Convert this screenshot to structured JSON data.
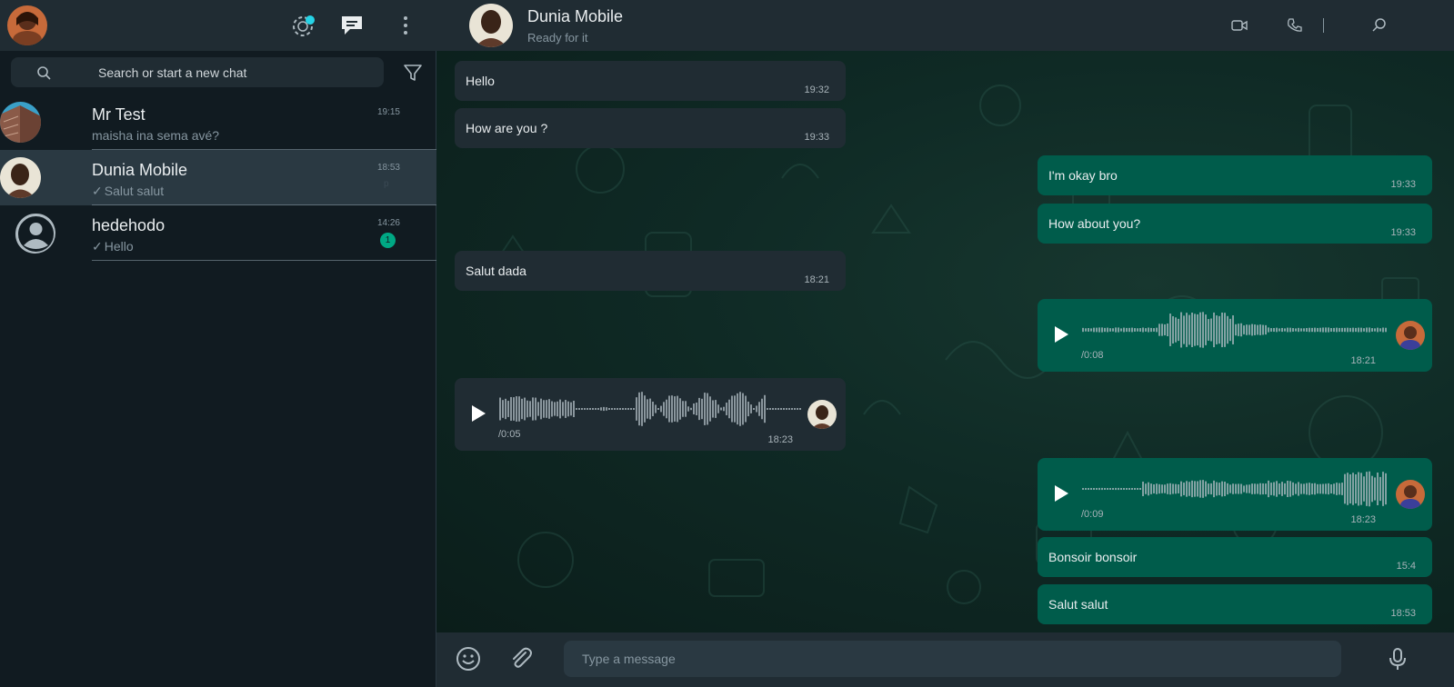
{
  "left": {
    "search": {
      "placeholder": "Search or start a new chat"
    },
    "chats": [
      {
        "name": "Mr Test",
        "last": "maisha ina sema avé?",
        "time": "19:15",
        "ticked": false,
        "unread": ""
      },
      {
        "name": "Dunia Mobile",
        "last": "Salut salut",
        "time": "18:53",
        "ticked": true,
        "unread": "",
        "extra": "p"
      },
      {
        "name": "hedehodo",
        "last": "Hello",
        "time": "14:26",
        "ticked": true,
        "unread": "1"
      }
    ]
  },
  "right": {
    "contact": {
      "name": "Dunia Mobile",
      "status": "Ready for it"
    },
    "messages": {
      "m1": {
        "text": "Hello",
        "time": "19:32"
      },
      "m2": {
        "text": "How are you ?",
        "time": "19:33"
      },
      "m3": {
        "text": "I'm okay bro",
        "time": "19:33"
      },
      "m4": {
        "text": "How about you?",
        "time": "19:33"
      },
      "m5": {
        "text": "Salut dada",
        "time": "18:21"
      },
      "v1": {
        "duration": "/0:08",
        "time": "18:21"
      },
      "v2": {
        "duration": "/0:05",
        "time": "18:23"
      },
      "v3": {
        "duration": "/0:09",
        "time": "18:23"
      },
      "m6": {
        "text": "Bonsoir bonsoir",
        "time": "15:4"
      },
      "m7": {
        "text": "Salut salut",
        "time": "18:53"
      }
    },
    "composer": {
      "placeholder": "Type a message"
    }
  },
  "colors": {
    "panel": "#111b21",
    "header": "#202c33",
    "incoming": "#202c33",
    "outgoing": "#005c4b",
    "accent": "#00a884",
    "status_dot": "#25d3e6"
  },
  "icons": [
    "status-icon",
    "new-chat-icon",
    "menu-icon",
    "search-icon",
    "filter-icon",
    "video-call-icon",
    "voice-call-icon",
    "emoji-icon",
    "attach-icon",
    "microphone-icon",
    "play-icon"
  ]
}
